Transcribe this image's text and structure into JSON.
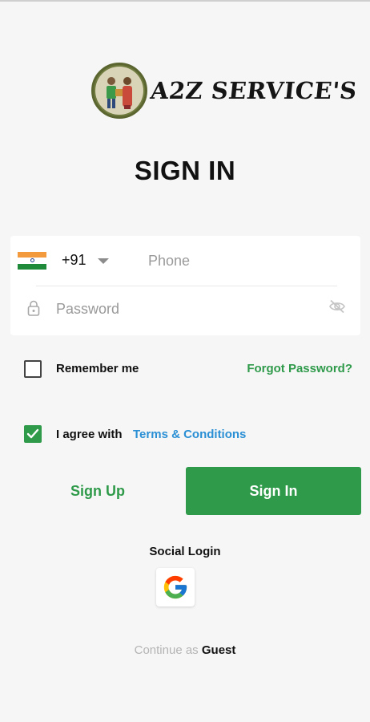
{
  "app": {
    "logo_text": "A2Z SERVICE'S",
    "title": "SIGN IN"
  },
  "phone": {
    "country_code": "+91",
    "placeholder": "Phone",
    "value": ""
  },
  "password": {
    "placeholder": "Password",
    "value": ""
  },
  "options": {
    "remember_label": "Remember me",
    "remember_checked": false,
    "forgot_label": "Forgot Password?",
    "agree_label": "I agree with",
    "agree_checked": true,
    "terms_label": "Terms & Conditions"
  },
  "actions": {
    "signup_label": "Sign Up",
    "signin_label": "Sign In"
  },
  "social": {
    "label": "Social Login"
  },
  "guest": {
    "prefix": "Continue as",
    "link": "Guest"
  },
  "colors": {
    "accent_green": "#2e9a4a",
    "link_blue": "#2a8fd4",
    "background": "#f6f6f6"
  }
}
